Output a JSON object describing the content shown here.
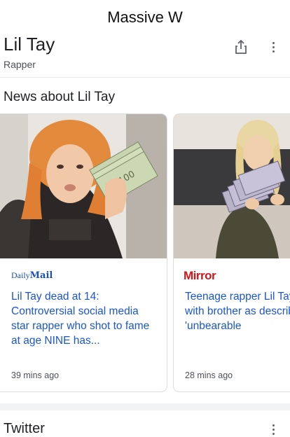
{
  "caption": "Massive W",
  "entity": {
    "title": "Lil Tay",
    "subtitle": "Rapper"
  },
  "news": {
    "section_title": "News about Lil Tay",
    "cards": [
      {
        "source": "Daily Mail",
        "source_prefix": "Daily",
        "source_suffix": "Mail",
        "headline": "Lil Tay dead at 14: Controversial social media star rapper who shot to fame at age NINE has...",
        "time": "39 mins ago"
      },
      {
        "source": "Mirror",
        "headline": "Teenage rapper Lil Tay along with brother as describe 'unbearable",
        "time": "28 mins ago"
      }
    ]
  },
  "twitter": {
    "section_title": "Twitter"
  },
  "icons": {
    "share": "share-icon",
    "more": "more-vert-icon"
  },
  "colors": {
    "link": "#1a55d6",
    "mirror_red": "#d7141a",
    "daily_mail_blue": "#1b4dbb"
  }
}
